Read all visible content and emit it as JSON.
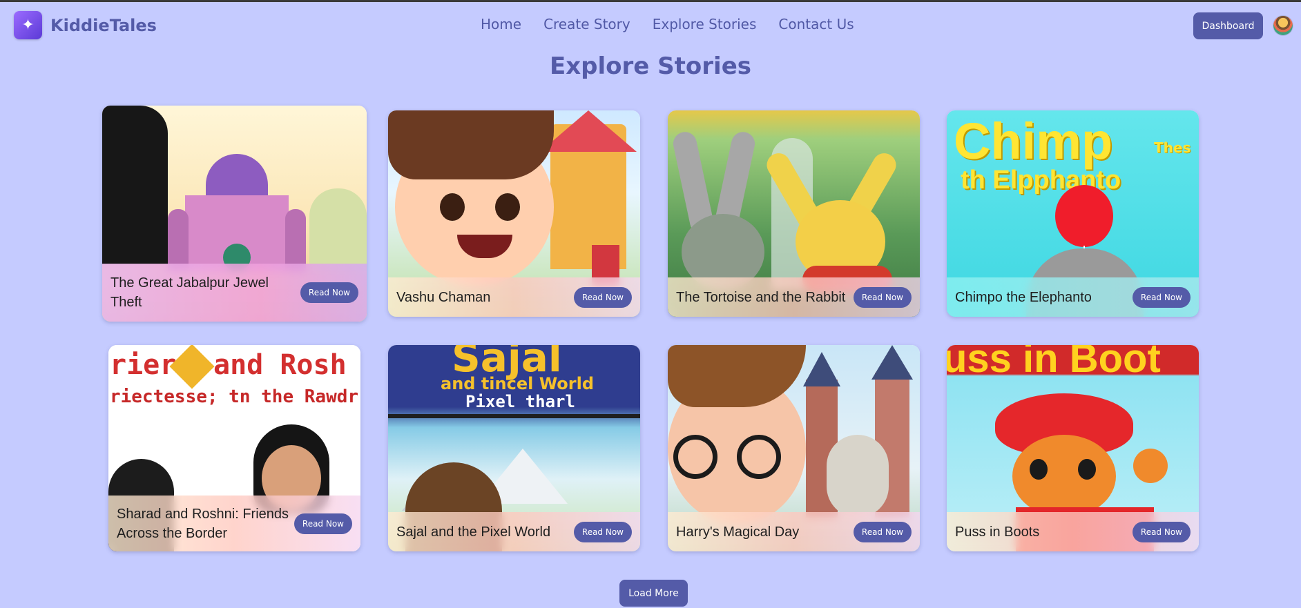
{
  "brand": {
    "name": "KiddieTales",
    "logo_icon": "sparkle-icon",
    "accent": "#545ba8"
  },
  "nav": {
    "links": [
      "Home",
      "Create Story",
      "Explore Stories",
      "Contact Us"
    ],
    "dashboard_label": "Dashboard"
  },
  "page": {
    "title": "Explore Stories"
  },
  "cards": [
    {
      "title": "The Great Jabalpur Jewel Theft",
      "button": "Read Now"
    },
    {
      "title": "Vashu Chaman",
      "button": "Read Now"
    },
    {
      "title": "The Tortoise and the Rabbit",
      "button": "Read Now"
    },
    {
      "title": "Chimpo the Elephanto",
      "button": "Read Now"
    },
    {
      "title": "Sharad and Roshni: Friends Across the Border",
      "button": "Read Now"
    },
    {
      "title": "Sajal and the Pixel World",
      "button": "Read Now"
    },
    {
      "title": "Harry's Magical Day",
      "button": "Read Now"
    },
    {
      "title": "Puss in Boots",
      "button": "Read Now"
    }
  ],
  "card_art_text": {
    "chimp_cover_1": "Chimp",
    "chimp_cover_2": "Thes",
    "chimp_cover_3": "th Elpphanto",
    "sharad_cover_1": "riera",
    "sharad_cover_2": "and Rosh",
    "sharad_cover_3": "riectesse; tn the Rawdr",
    "sajal_cover_1": "Sajal",
    "sajal_cover_2": "and tincel World",
    "sajal_cover_3": "Pixel tharl",
    "puss_cover_1": "uss in Boot"
  },
  "load_more_label": "Load More"
}
